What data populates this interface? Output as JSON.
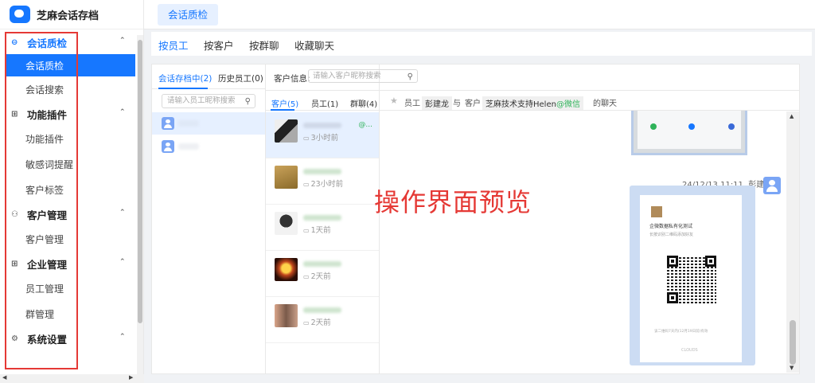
{
  "app": {
    "title": "芝麻会话存档"
  },
  "sidebar": {
    "groups": [
      {
        "label": "会话质检",
        "icon": "chat-circle-icon",
        "items": [
          "会话质检",
          "会话搜索"
        ]
      },
      {
        "label": "功能插件",
        "icon": "grid-icon",
        "items": [
          "功能插件",
          "敏感词提醒",
          "客户标签"
        ]
      },
      {
        "label": "客户管理",
        "icon": "people-icon",
        "items": [
          "客户管理"
        ]
      },
      {
        "label": "企业管理",
        "icon": "grid-icon",
        "items": [
          "员工管理",
          "群管理"
        ]
      },
      {
        "label": "系统设置",
        "icon": "gear-icon",
        "items": []
      }
    ],
    "selected_item": "会话质检"
  },
  "top_tab": {
    "label": "会话质检"
  },
  "sub_tabs": [
    "按员工",
    "按客户",
    "按群聊",
    "收藏聊天"
  ],
  "employee_panel": {
    "tabs": [
      "会话存档中(2)",
      "历史员工(0)"
    ],
    "search_placeholder": "请输入员工昵称搜索"
  },
  "customer_panel": {
    "label": "客户信息:",
    "search_placeholder": "请输入客户昵称搜索",
    "tabs": [
      "客户(5)",
      "员工(1)",
      "群聊(4)"
    ],
    "rows": [
      {
        "time": "3小时前",
        "tag": "@..."
      },
      {
        "time": "23小时前",
        "tag": ""
      },
      {
        "time": "1天前",
        "tag": ""
      },
      {
        "time": "2天前",
        "tag": ""
      },
      {
        "time": "2天前",
        "tag": ""
      }
    ]
  },
  "chat": {
    "header": {
      "prefix": "员工",
      "employee": "彭建龙",
      "mid": "与",
      "customer_prefix": "客户",
      "customer": "芝麻技术支持Helen",
      "customer_suffix": "@微信",
      "suffix": "的聊天"
    },
    "message": {
      "time": "24/12/13 11:11",
      "sender": "彭建龙",
      "card_title": "企微数据私有化测试",
      "card_sub": "长按识别二维码添加好友",
      "card_foot": "该二维码7天内(12月19日前)有效",
      "card_logo": "CLOUDS"
    }
  },
  "overlay": {
    "text": "操作界面预览"
  }
}
